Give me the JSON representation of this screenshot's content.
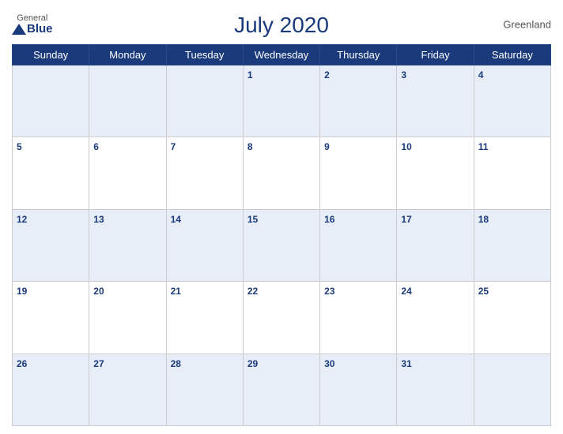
{
  "header": {
    "title": "July 2020",
    "region": "Greenland",
    "logo_general": "General",
    "logo_blue": "Blue"
  },
  "days_of_week": [
    "Sunday",
    "Monday",
    "Tuesday",
    "Wednesday",
    "Thursday",
    "Friday",
    "Saturday"
  ],
  "weeks": [
    [
      null,
      null,
      null,
      1,
      2,
      3,
      4
    ],
    [
      5,
      6,
      7,
      8,
      9,
      10,
      11
    ],
    [
      12,
      13,
      14,
      15,
      16,
      17,
      18
    ],
    [
      19,
      20,
      21,
      22,
      23,
      24,
      25
    ],
    [
      26,
      27,
      28,
      29,
      30,
      31,
      null
    ]
  ],
  "colors": {
    "header_bg": "#1a3a7c",
    "row_odd_bg": "#e8eef8",
    "row_even_bg": "#ffffff"
  }
}
